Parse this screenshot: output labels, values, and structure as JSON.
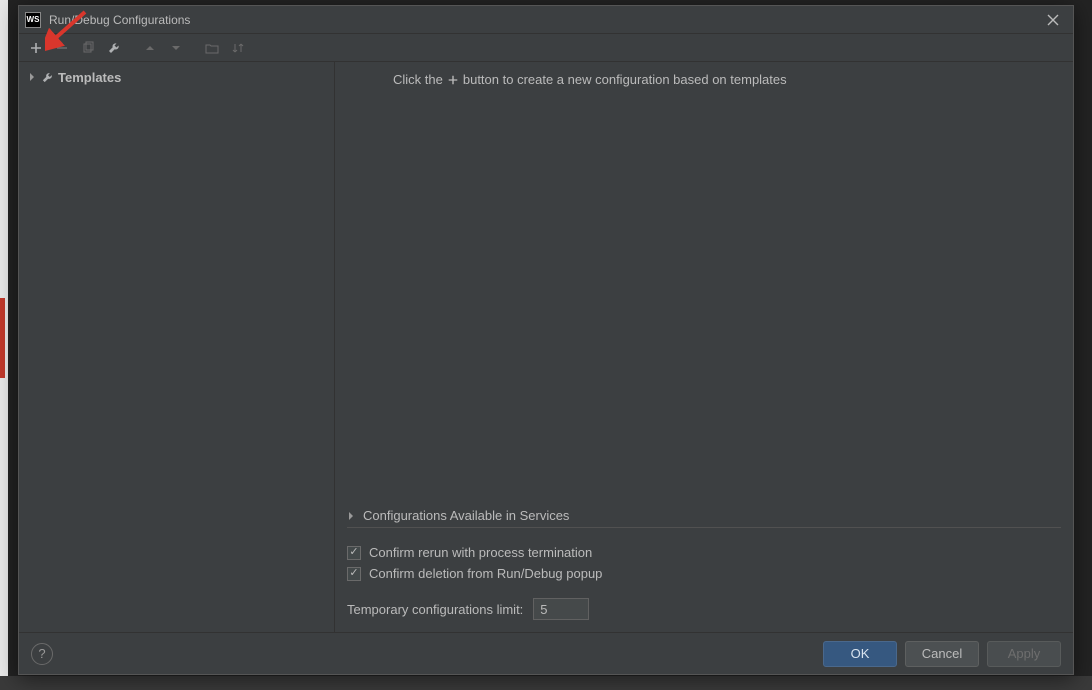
{
  "window": {
    "title": "Run/Debug Configurations",
    "app_icon_text": "WS"
  },
  "sidebar": {
    "templates_label": "Templates"
  },
  "main": {
    "hint_prefix": "Click the",
    "hint_suffix": "button to create a new configuration based on templates",
    "section_label": "Configurations Available in Services",
    "checkbox1_label": "Confirm rerun with process termination",
    "checkbox1_checked": true,
    "checkbox2_label": "Confirm deletion from Run/Debug popup",
    "checkbox2_checked": true,
    "limit_label": "Temporary configurations limit:",
    "limit_value": "5"
  },
  "footer": {
    "ok": "OK",
    "cancel": "Cancel",
    "apply": "Apply"
  },
  "toolbar_icons": {
    "add": "add-icon",
    "remove": "remove-icon",
    "copy": "copy-icon",
    "edit": "wrench-icon",
    "up": "up-icon",
    "down": "down-icon",
    "folder": "folder-icon",
    "sort": "sort-icon"
  },
  "background": {
    "bottom_text": ""
  }
}
